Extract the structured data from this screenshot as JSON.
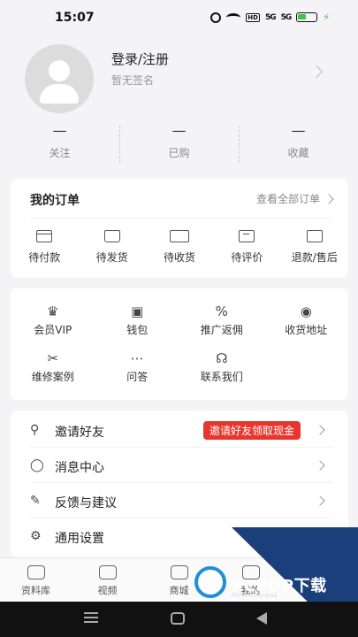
{
  "status_bar": {
    "time": "15:07",
    "hd": "HD",
    "sig1": "5G",
    "sig2": "5G"
  },
  "profile": {
    "login": "登录/注册",
    "signature": "暂无签名"
  },
  "stats": [
    {
      "value": "—",
      "label": "关注"
    },
    {
      "value": "—",
      "label": "已购"
    },
    {
      "value": "—",
      "label": "收藏"
    }
  ],
  "orders": {
    "title": "我的订单",
    "view_all": "查看全部订单",
    "items": [
      {
        "label": "待付款",
        "icon": "wallet-card-icon"
      },
      {
        "label": "待发货",
        "icon": "package-icon"
      },
      {
        "label": "待收货",
        "icon": "truck-icon"
      },
      {
        "label": "待评价",
        "icon": "comment-icon"
      },
      {
        "label": "退款/售后",
        "icon": "refund-icon"
      }
    ]
  },
  "services": [
    {
      "label": "会员VIP",
      "icon": "crown-icon",
      "glyph": "♛"
    },
    {
      "label": "钱包",
      "icon": "wallet-icon",
      "glyph": "▣"
    },
    {
      "label": "推广返佣",
      "icon": "percent-icon",
      "glyph": "%"
    },
    {
      "label": "收货地址",
      "icon": "location-icon",
      "glyph": "◉"
    },
    {
      "label": "维修案例",
      "icon": "tools-icon",
      "glyph": "✂"
    },
    {
      "label": "问答",
      "icon": "qa-icon",
      "glyph": "⋯"
    },
    {
      "label": "联系我们",
      "icon": "headset-icon",
      "glyph": "☊"
    }
  ],
  "menu": {
    "items": [
      {
        "label": "邀请好友",
        "icon": "user-icon",
        "glyph": "⚲"
      },
      {
        "label": "消息中心",
        "icon": "message-icon",
        "glyph": "◯"
      },
      {
        "label": "反馈与建议",
        "icon": "feedback-icon",
        "glyph": "✎"
      },
      {
        "label": "通用设置",
        "icon": "gear-icon",
        "glyph": "⚙"
      }
    ],
    "promo": "邀请好友领取现金",
    "promo_color": "#e8362f"
  },
  "tabbar": [
    {
      "label": "资料库",
      "icon": "library-icon"
    },
    {
      "label": "视频",
      "icon": "video-icon"
    },
    {
      "label": "商城",
      "icon": "shop-icon"
    },
    {
      "label": "我的",
      "icon": "profile-icon"
    }
  ],
  "watermark": {
    "brand": "PCPOP下载",
    "sub": "PCPOP Download"
  }
}
